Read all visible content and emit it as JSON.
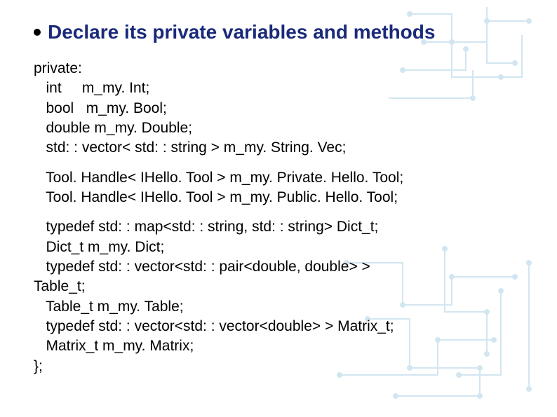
{
  "slide": {
    "title": "Declare its private variables and methods",
    "code": {
      "block1": [
        "private:",
        "   int     m_my. Int;",
        "   bool   m_my. Bool;",
        "   double m_my. Double;",
        "   std: : vector< std: : string > m_my. String. Vec;"
      ],
      "block2": [
        "   Tool. Handle< IHello. Tool > m_my. Private. Hello. Tool;",
        "   Tool. Handle< IHello. Tool > m_my. Public. Hello. Tool;"
      ],
      "block3": [
        "   typedef std: : map<std: : string, std: : string> Dict_t;",
        "   Dict_t m_my. Dict;",
        "   typedef std: : vector<std: : pair<double, double> >",
        "Table_t;",
        "   Table_t m_my. Table;",
        "   typedef std: : vector<std: : vector<double> > Matrix_t;",
        "   Matrix_t m_my. Matrix;",
        "};"
      ]
    }
  },
  "colors": {
    "title": "#1a2a7a",
    "circuit": "#7fb8d9"
  }
}
